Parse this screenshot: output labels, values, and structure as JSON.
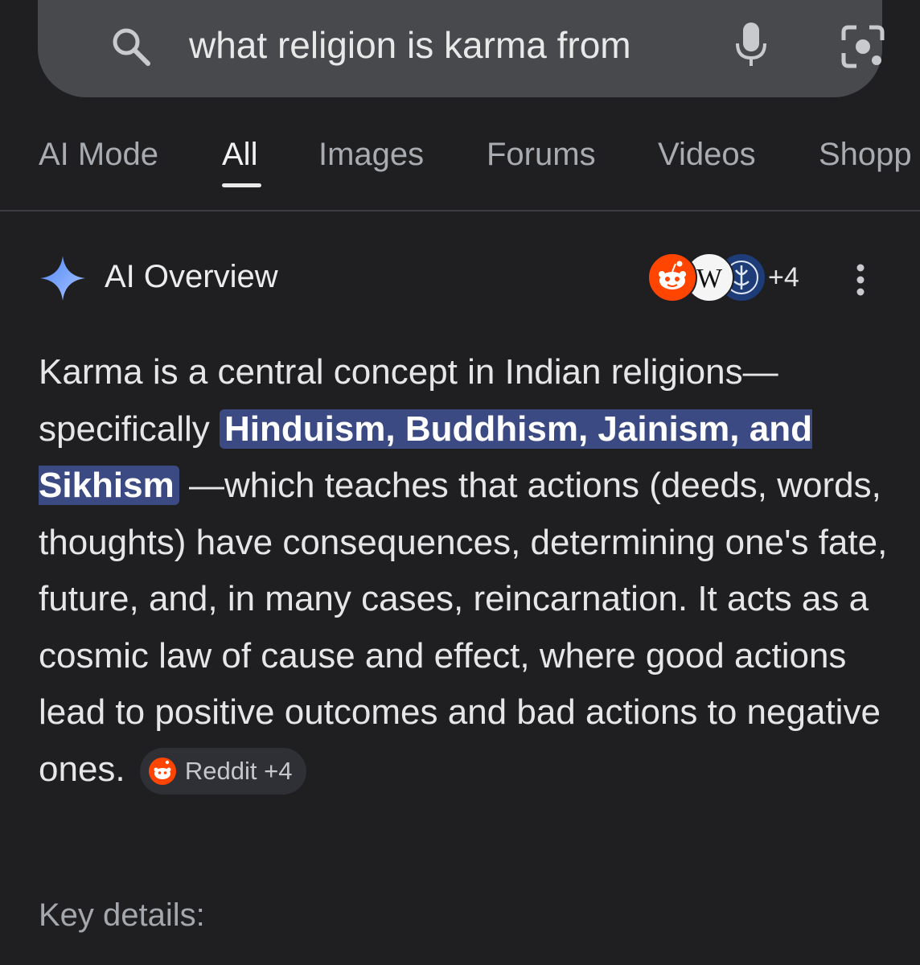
{
  "search": {
    "query": "what religion is karma from",
    "icons": [
      "search-icon",
      "mic-icon",
      "lens-icon"
    ]
  },
  "tabs": [
    {
      "label": "AI Mode",
      "active": false
    },
    {
      "label": "All",
      "active": true
    },
    {
      "label": "Images",
      "active": false
    },
    {
      "label": "Forums",
      "active": false
    },
    {
      "label": "Videos",
      "active": false
    },
    {
      "label": "Shopp",
      "active": false
    }
  ],
  "overview": {
    "title": "AI Overview",
    "source_count": "+4",
    "source_icons": [
      "reddit-icon",
      "wikipedia-icon",
      "seal-icon"
    ],
    "body": {
      "part1": "Karma is a central concept in Indian religions—specifically ",
      "highlight": "Hinduism, Buddhism, Jainism, and Sikhism",
      "part2": " —which teaches that actions (deeds, words, thoughts) have consequences, determining one's fate, future, and, in many cases, reincarnation. It acts as a cosmic law of cause and effect, where good actions lead to positive outcomes and bad actions to negative ones. "
    },
    "chip_label": "Reddit +4",
    "key_details": "Key details:"
  },
  "colors": {
    "background": "#1f1f22",
    "search_bar": "#48494d",
    "highlight": "#3c4a83",
    "sparkle": "#7aa7ff",
    "reddit": "#ff4500"
  }
}
